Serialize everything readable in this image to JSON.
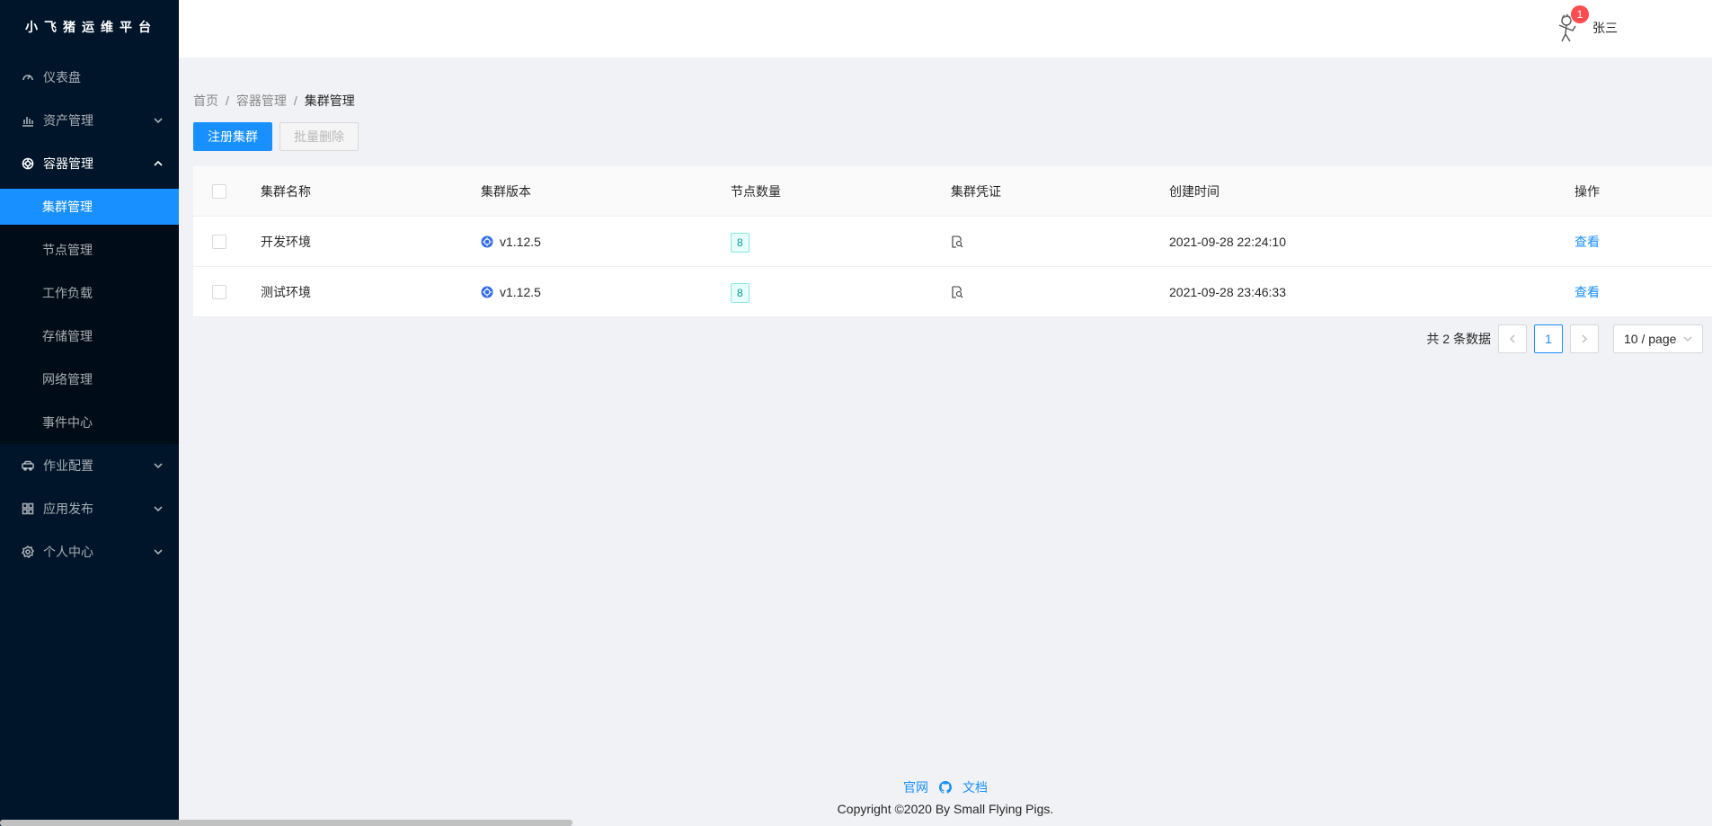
{
  "app": {
    "logo_text": "小飞猪运维平台"
  },
  "sidebar": {
    "items": [
      {
        "label": "仪表盘",
        "icon": "dashboard-icon"
      },
      {
        "label": "资产管理",
        "icon": "bar-chart-icon"
      },
      {
        "label": "容器管理",
        "icon": "container-icon"
      },
      {
        "label": "作业配置",
        "icon": "car-icon"
      },
      {
        "label": "应用发布",
        "icon": "apps-icon"
      },
      {
        "label": "个人中心",
        "icon": "setting-icon"
      }
    ],
    "submenu": [
      {
        "label": "集群管理",
        "active": true
      },
      {
        "label": "节点管理"
      },
      {
        "label": "工作负载"
      },
      {
        "label": "存储管理"
      },
      {
        "label": "网络管理"
      },
      {
        "label": "事件中心"
      }
    ]
  },
  "header": {
    "username": "张三",
    "notification_count": "1"
  },
  "breadcrumb": {
    "items": [
      "首页",
      "容器管理",
      "集群管理"
    ],
    "separator": "/"
  },
  "toolbar": {
    "register_label": "注册集群",
    "batch_delete_label": "批量删除"
  },
  "table": {
    "columns": [
      "集群名称",
      "集群版本",
      "节点数量",
      "集群凭证",
      "创建时间",
      "操作"
    ],
    "rows": [
      {
        "name": "开发环境",
        "version": "v1.12.5",
        "nodes": "8",
        "created": "2021-09-28 22:24:10",
        "action": "查看"
      },
      {
        "name": "测试环境",
        "version": "v1.12.5",
        "nodes": "8",
        "created": "2021-09-28 23:46:33",
        "action": "查看"
      }
    ]
  },
  "pagination": {
    "total_text": "共 2 条数据",
    "current_page": "1",
    "page_size": "10 / page"
  },
  "footer": {
    "link_site": "官网",
    "link_docs": "文档",
    "copyright": "Copyright ©2020 By Small Flying Pigs."
  },
  "colors": {
    "sider_bg": "#001529",
    "primary": "#1890ff",
    "badge": "#ff4d4f",
    "tag": "#08979c"
  }
}
